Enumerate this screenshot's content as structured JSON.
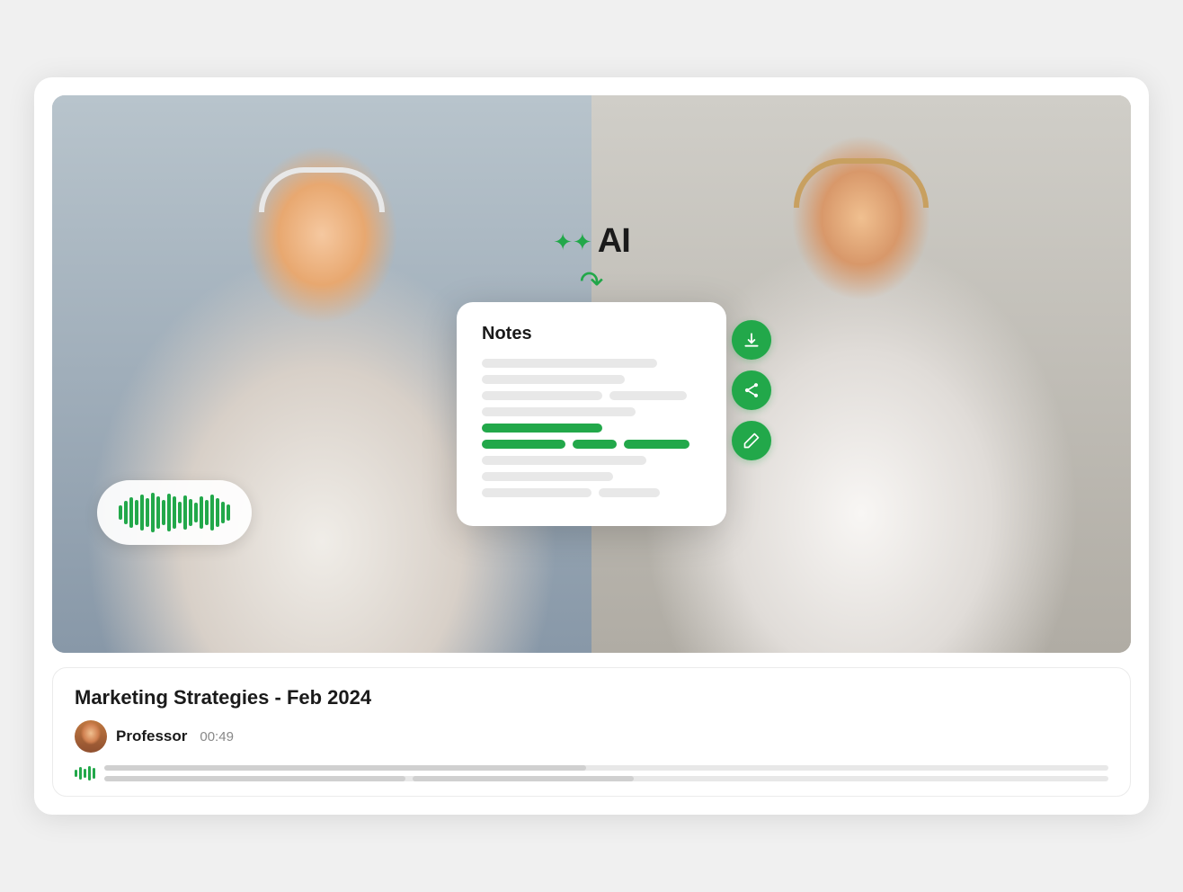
{
  "meeting": {
    "title": "Marketing Strategies - Feb 2024",
    "speaker": "Professor",
    "time": "00:49"
  },
  "notes": {
    "title": "Notes"
  },
  "ai": {
    "label": "AI"
  },
  "actions": {
    "download": "download",
    "share": "share",
    "edit": "edit"
  },
  "waveform": {
    "bars": [
      4,
      7,
      12,
      9,
      14,
      11,
      16,
      13,
      10,
      15,
      12,
      8,
      13,
      10,
      7,
      12,
      9,
      14,
      11,
      8,
      6
    ]
  }
}
